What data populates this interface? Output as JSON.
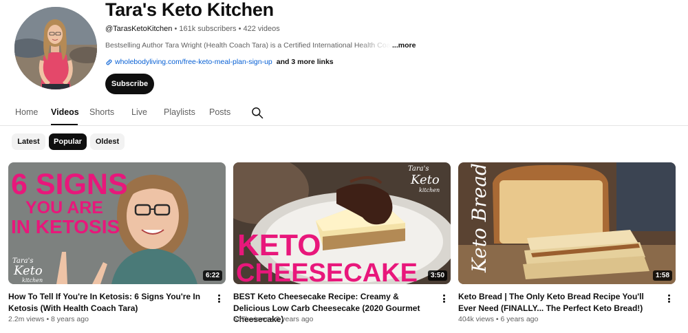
{
  "channel": {
    "title": "Tara's Keto Kitchen",
    "handle": "@TarasKetoKitchen",
    "subscribers": "161k subscribers",
    "videos_count": "422 videos",
    "separator": "•",
    "description": "Bestselling Author Tara Wright (Health Coach Tara) is a Certified International Health Coach",
    "more_label": "...more",
    "link_text": "wholebodyliving.com/free-keto-meal-plan-sign-up",
    "more_links": "and 3 more links",
    "subscribe_label": "Subscribe"
  },
  "tabs": [
    {
      "label": "Home",
      "active": false
    },
    {
      "label": "Videos",
      "active": true
    },
    {
      "label": "Shorts",
      "active": false
    },
    {
      "label": "Live",
      "active": false
    },
    {
      "label": "Playlists",
      "active": false
    },
    {
      "label": "Posts",
      "active": false
    }
  ],
  "chips": [
    {
      "label": "Latest",
      "active": false
    },
    {
      "label": "Popular",
      "active": true
    },
    {
      "label": "Oldest",
      "active": false
    }
  ],
  "videos": [
    {
      "title": "How To Tell If You're In Ketosis: 6 Signs You're In Ketosis (With Health Coach Tara)",
      "views": "2.2m views",
      "age": "8 years ago",
      "duration": "6:22",
      "thumb_lines": [
        "6 SIGNS",
        "YOU ARE",
        "IN KETOSIS"
      ],
      "thumb_logo": [
        "Tara's",
        "Keto",
        "kitchen"
      ]
    },
    {
      "title": "BEST Keto Cheesecake Recipe: Creamy & Delicious Low Carb Cheesecake (2020 Gourmet Cheesecake)",
      "views": "547k views",
      "age": "8 years ago",
      "duration": "3:50",
      "thumb_lines": [
        "KETO",
        "CHEESECAKE"
      ],
      "thumb_logo": [
        "Tara's",
        "Keto",
        "kitchen"
      ]
    },
    {
      "title": "Keto Bread | The Only Keto Bread Recipe You'll Ever Need (FINALLY... The Perfect Keto Bread!)",
      "views": "404k views",
      "age": "6 years ago",
      "duration": "1:58",
      "thumb_lines": [
        "Keto Bread"
      ]
    }
  ],
  "icons": {
    "search": "search-icon",
    "link": "link-icon",
    "more": "more-vert-icon"
  },
  "colors": {
    "link": "#065fd4",
    "thumb_magenta": "#e8177b",
    "subscribe_bg": "#0f0f0f"
  }
}
